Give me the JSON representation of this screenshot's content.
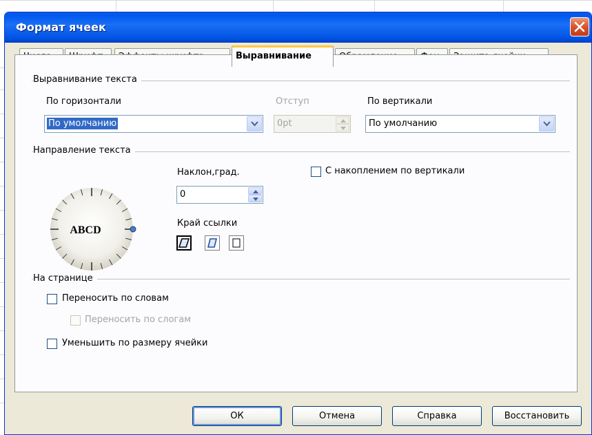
{
  "dialog": {
    "title": "Формат ячеек"
  },
  "tabs": [
    {
      "label": "Числа"
    },
    {
      "label": "Шрифт"
    },
    {
      "label": "Эффекты шрифта"
    },
    {
      "label": "Выравнивание",
      "active": true
    },
    {
      "label": "Обрамление"
    },
    {
      "label": "Фон"
    },
    {
      "label": "Защита ячейки"
    }
  ],
  "text_alignment": {
    "section_title": "Выравнивание текста",
    "horizontal_label": "По горизонтали",
    "horizontal_value": "По умолчанию",
    "indent_label": "Отступ",
    "indent_value": "0pt",
    "vertical_label": "По вертикали",
    "vertical_value": "По умолчанию"
  },
  "text_direction": {
    "section_title": "Направление текста",
    "dial_text": "ABCD",
    "angle_label": "Наклон,град.",
    "angle_value": "0",
    "reference_edge_label": "Край ссылки",
    "stacked_label": "С накоплением по вертикали"
  },
  "page": {
    "section_title": "На странице",
    "wrap_words_label": "Переносить по словам",
    "hyphenation_label": "Переносить по слогам",
    "shrink_label": "Уменьшить по размеру ячейки"
  },
  "buttons": {
    "ok": "ОК",
    "cancel": "Отмена",
    "help": "Справка",
    "reset": "Восстановить"
  },
  "colors": {
    "titlebar": "#0054e3",
    "active_tab_accent": "#ffc83c",
    "selection": "#316ac5",
    "close_button": "#d9542e"
  }
}
